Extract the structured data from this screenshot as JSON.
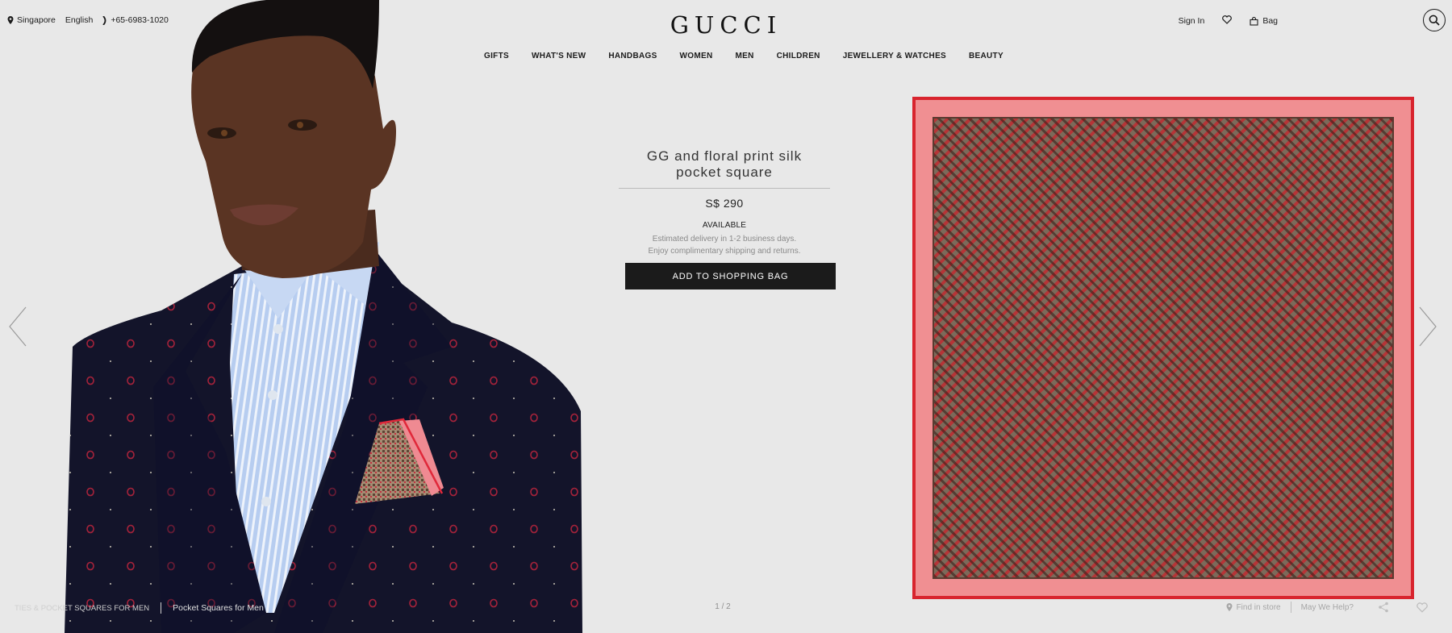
{
  "topbar": {
    "location": "Singapore",
    "language": "English",
    "phone": "+65-6983-1020",
    "sign_in": "Sign In",
    "bag": "Bag"
  },
  "brand": {
    "logo": "GUCCI"
  },
  "nav": {
    "items": [
      {
        "label": "GIFTS"
      },
      {
        "label": "WHAT'S NEW"
      },
      {
        "label": "HANDBAGS"
      },
      {
        "label": "WOMEN"
      },
      {
        "label": "MEN"
      },
      {
        "label": "CHILDREN"
      },
      {
        "label": "JEWELLERY & WATCHES"
      },
      {
        "label": "BEAUTY"
      }
    ]
  },
  "product": {
    "title_line1": "GG and floral print silk",
    "title_line2": "pocket square",
    "price": "S$ 290",
    "availability": "AVAILABLE",
    "delivery_note": "Estimated delivery in 1-2 business days.",
    "shipping_note": "Enjoy complimentary shipping and returns.",
    "add_to_bag": "ADD TO SHOPPING BAG"
  },
  "footer": {
    "breadcrumb_1": "TIES & POCKET SQUARES FOR MEN",
    "breadcrumb_2": "Pocket Squares for Men",
    "pager": "1 / 2",
    "find_in_store": "Find in store",
    "help": "May We Help?"
  },
  "colors": {
    "background": "#e8e8e8",
    "button": "#1b1b1b",
    "scarf_border": "#d8242e",
    "scarf_pink": "#f08f92"
  },
  "icons": [
    "location-pin-icon",
    "phone-icon",
    "heart-icon",
    "bag-icon",
    "search-icon",
    "chevron-left-icon",
    "chevron-right-icon",
    "share-icon"
  ]
}
